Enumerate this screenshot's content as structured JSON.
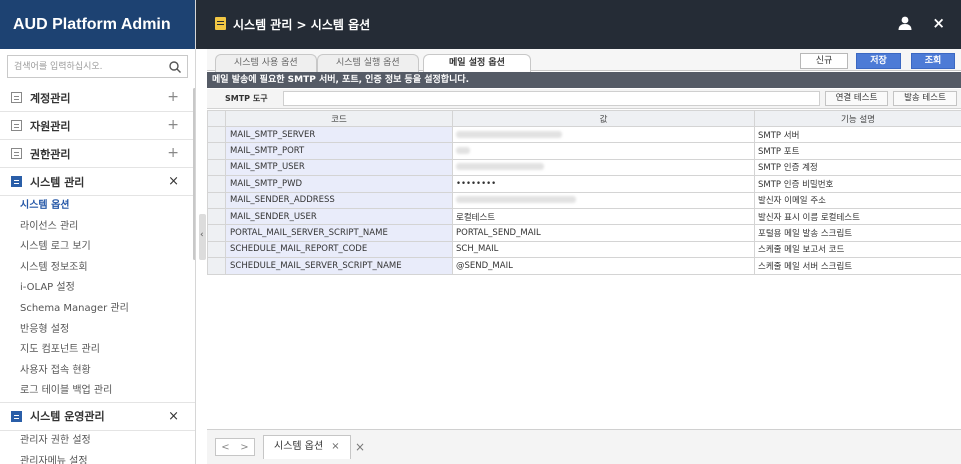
{
  "app": {
    "brand": "AUD Platform Admin"
  },
  "search": {
    "placeholder": "검색어를 입력하십시오."
  },
  "sidebar": {
    "categories": [
      {
        "label": "계정관리",
        "toggle": "+"
      },
      {
        "label": "자원관리",
        "toggle": "+"
      },
      {
        "label": "권한관리",
        "toggle": "+"
      },
      {
        "label": "시스템 관리",
        "toggle": "×"
      },
      {
        "label": "시스템 운영관리",
        "toggle": "×"
      }
    ],
    "system_items": [
      "시스템 옵션",
      "라이선스 관리",
      "시스템 로그 보기",
      "시스템 정보조회",
      "i-OLAP 설정",
      "Schema Manager 관리",
      "반응형 설정",
      "지도 컴포넌트 관리",
      "사용자 접속 현황",
      "로그 테이블 백업 관리"
    ],
    "ops_items": [
      "관리자 권한 설정",
      "관리자메뉴 설정"
    ],
    "grip": "‹"
  },
  "header": {
    "title": "시스템 관리 > 시스템 옵션",
    "close": "×"
  },
  "tabs": [
    "시스템 사용 옵션",
    "시스템 실행 옵션",
    "메일 설정 옵션"
  ],
  "actions": {
    "new": "신규",
    "save": "저장",
    "search": "조회"
  },
  "description": "메일 발송에 필요한 SMTP 서버, 포트, 인증 정보 등을 설정합니다.",
  "toolbar": {
    "label": "SMTP 도구",
    "connect_test": "연결 테스트",
    "send_test": "발송 테스트"
  },
  "grid": {
    "columns": [
      "코드",
      "값",
      "기능 설명"
    ],
    "rows": [
      {
        "code": "MAIL_SMTP_SERVER",
        "value": "",
        "desc": "SMTP 서버"
      },
      {
        "code": "MAIL_SMTP_PORT",
        "value": "",
        "desc": "SMTP 포트"
      },
      {
        "code": "MAIL_SMTP_USER",
        "value": "",
        "desc": "SMTP 인증 계정"
      },
      {
        "code": "MAIL_SMTP_PWD",
        "value": "••••••••",
        "desc": "SMTP 인증 비밀번호"
      },
      {
        "code": "MAIL_SENDER_ADDRESS",
        "value": "",
        "desc": "발신자 이메일 주소"
      },
      {
        "code": "MAIL_SENDER_USER",
        "value": "로컬테스트",
        "desc": "발신자 표시 이름 로컬테스트"
      },
      {
        "code": "PORTAL_MAIL_SERVER_SCRIPT_NAME",
        "value": "PORTAL_SEND_MAIL",
        "desc": "포털용 메일 발송 스크립트"
      },
      {
        "code": "SCHEDULE_MAIL_REPORT_CODE",
        "value": "SCH_MAIL",
        "desc": "스케줄 메일 보고서 코드"
      },
      {
        "code": "SCHEDULE_MAIL_SERVER_SCRIPT_NAME",
        "value": "@SEND_MAIL",
        "desc": "스케줄 메일 서버 스크립트"
      }
    ]
  },
  "footer": {
    "prev": "<",
    "next": ">",
    "tab": "시스템 옵션",
    "tab_close": "×",
    "close_all": "×"
  },
  "colors": {
    "brand_bg": "#1d4272",
    "header_bg": "#252c36",
    "accent": "#4d7bd6",
    "desc_bar": "#555b66"
  }
}
